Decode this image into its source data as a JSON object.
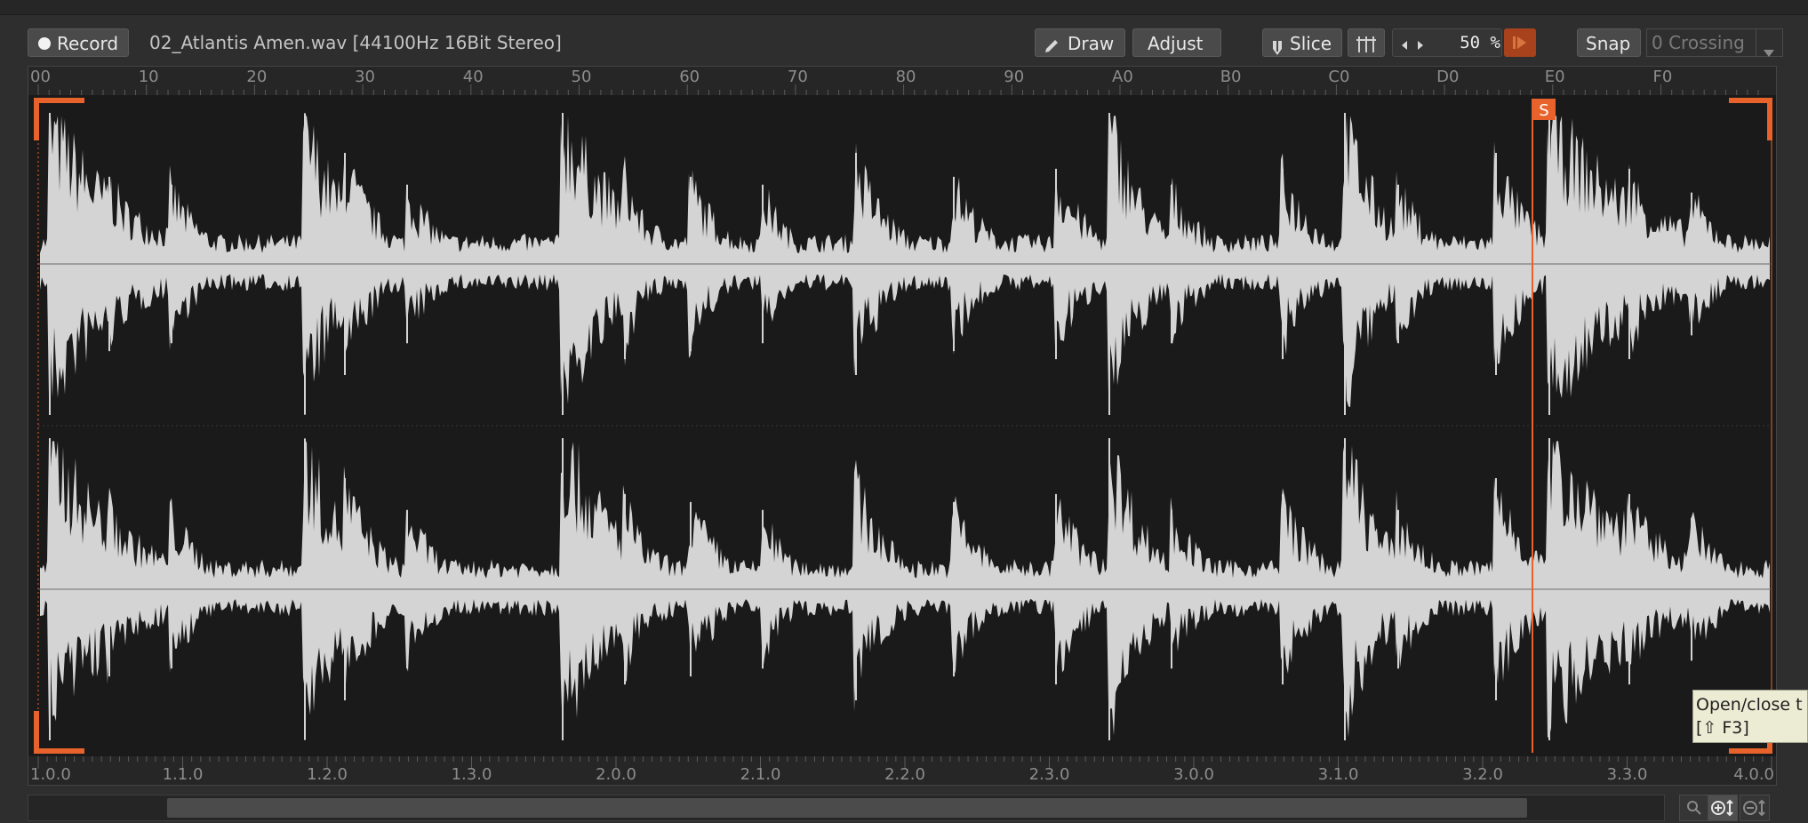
{
  "toolbar": {
    "record_label": "Record",
    "filename": "02_Atlantis Amen.wav [44100Hz 16Bit Stereo]",
    "draw_label": "Draw",
    "adjust_label": "Adjust",
    "slice_label": "Slice",
    "zoom_value": "50 %",
    "snap_label": "Snap",
    "snap_mode": "0 Crossing"
  },
  "ruler_top": {
    "labels": [
      "00",
      "10",
      "20",
      "30",
      "40",
      "50",
      "60",
      "70",
      "80",
      "90",
      "A0",
      "B0",
      "C0",
      "D0",
      "E0",
      "F0"
    ]
  },
  "ruler_bottom": {
    "labels": [
      "1.0.0",
      "1.1.0",
      "1.2.0",
      "1.3.0",
      "2.0.0",
      "2.1.0",
      "2.2.0",
      "2.3.0",
      "3.0.0",
      "3.1.0",
      "3.2.0",
      "3.3.0",
      "4.0.0"
    ]
  },
  "markers": {
    "slice_marker_label": "S"
  },
  "tooltip": {
    "line1": "Open/close t",
    "line2": "[⇧ F3]"
  },
  "colors": {
    "accent": "#e8632b",
    "waveform": "#d4d4d4",
    "editor_bg": "#1a1a1a"
  },
  "icons": [
    "record-dot-icon",
    "pencil-icon",
    "slice-icon",
    "grid-icon",
    "arrow-left-icon",
    "arrow-right-icon",
    "play-marker-icon",
    "dropdown-arrow-icon",
    "search-icon",
    "zoom-in-vertical-icon",
    "zoom-out-vertical-icon"
  ]
}
